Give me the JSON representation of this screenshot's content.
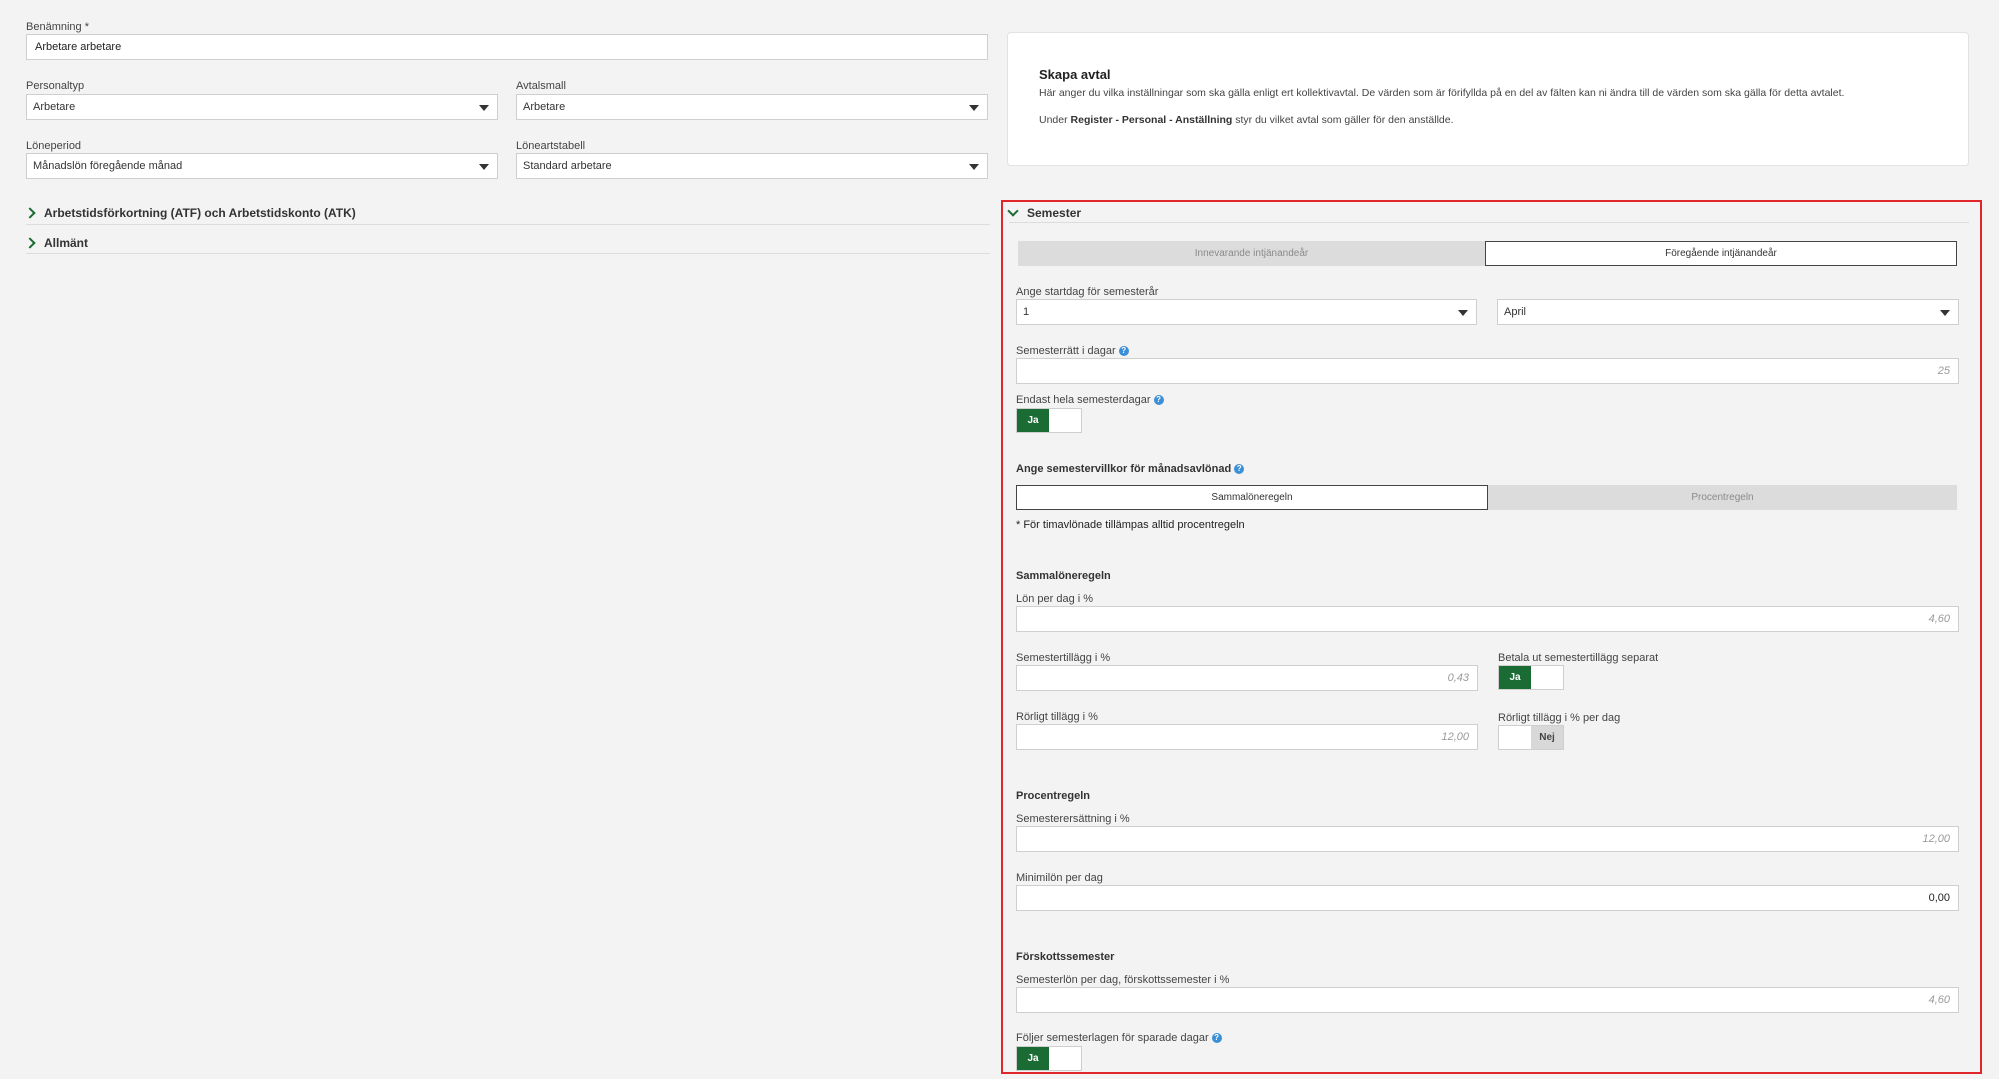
{
  "form": {
    "benamning_label": "Benämning *",
    "benamning_value": "Arbetare arbetare",
    "personaltyp_label": "Personaltyp",
    "personaltyp_value": "Arbetare",
    "avtalsmall_label": "Avtalsmall",
    "avtalsmall_value": "Arbetare",
    "loneperiod_label": "Löneperiod",
    "loneperiod_value": "Månadslön föregående månad",
    "loneartstabell_label": "Löneartstabell",
    "loneartstabell_value": "Standard arbetare"
  },
  "sections": {
    "atf": "Arbetstidsförkortning (ATF) och Arbetstidskonto (ATK)",
    "allmant": "Allmänt"
  },
  "info": {
    "title": "Skapa avtal",
    "line1": "Här anger du vilka inställningar som ska gälla enligt ert kollektivavtal. De värden som är förifyllda på en del av fälten kan ni ändra till de värden som ska gälla för detta avtalet.",
    "line2_prefix": "Under ",
    "line2_bold": "Register - Personal - Anställning",
    "line2_suffix": " styr du vilket avtal som gäller för den anställde."
  },
  "semester": {
    "title": "Semester",
    "tab_current": "Innevarande intjänandeår",
    "tab_previous": "Föregående intjänandeår",
    "startdag_label": "Ange startdag för semesterår",
    "startdag_day": "1",
    "startdag_month": "April",
    "semesterratt_label": "Semesterrätt i dagar",
    "semesterratt_value": "25",
    "endast_hela_label": "Endast hela semesterdagar",
    "endast_hela_value": "Ja",
    "villkor_label": "Ange semestervillkor för månadsavlönad",
    "tab_sammalone": "Sammalöneregeln",
    "tab_procent": "Procentregeln",
    "timavlonade_note": "* För timavlönade tillämpas alltid procentregeln",
    "sammalone_heading": "Sammalöneregeln",
    "lon_per_dag_label": "Lön per dag i %",
    "lon_per_dag_value": "4,60",
    "semestertillagg_label": "Semestertillägg i %",
    "semestertillagg_value": "0,43",
    "betala_ut_label": "Betala ut semestertillägg separat",
    "betala_ut_value": "Ja",
    "rorligt_label": "Rörligt tillägg i %",
    "rorligt_value": "12,00",
    "rorligt_per_dag_label": "Rörligt tillägg i % per dag",
    "rorligt_per_dag_value": "Nej",
    "procent_heading": "Procentregeln",
    "semesterersattning_label": "Semesterersättning i %",
    "semesterersattning_value": "12,00",
    "minimilon_label": "Minimilön per dag",
    "minimilon_value": "0,00",
    "forskott_heading": "Förskottssemester",
    "semesterlon_label": "Semesterlön per dag, förskottssemester i %",
    "semesterlon_value": "4,60",
    "foljer_label": "Följer semesterlagen för sparade dagar",
    "foljer_value": "Ja"
  },
  "colors": {
    "accent_green": "#1a6b34",
    "highlight_red": "#e0262b",
    "help_blue": "#3b8fd6"
  }
}
